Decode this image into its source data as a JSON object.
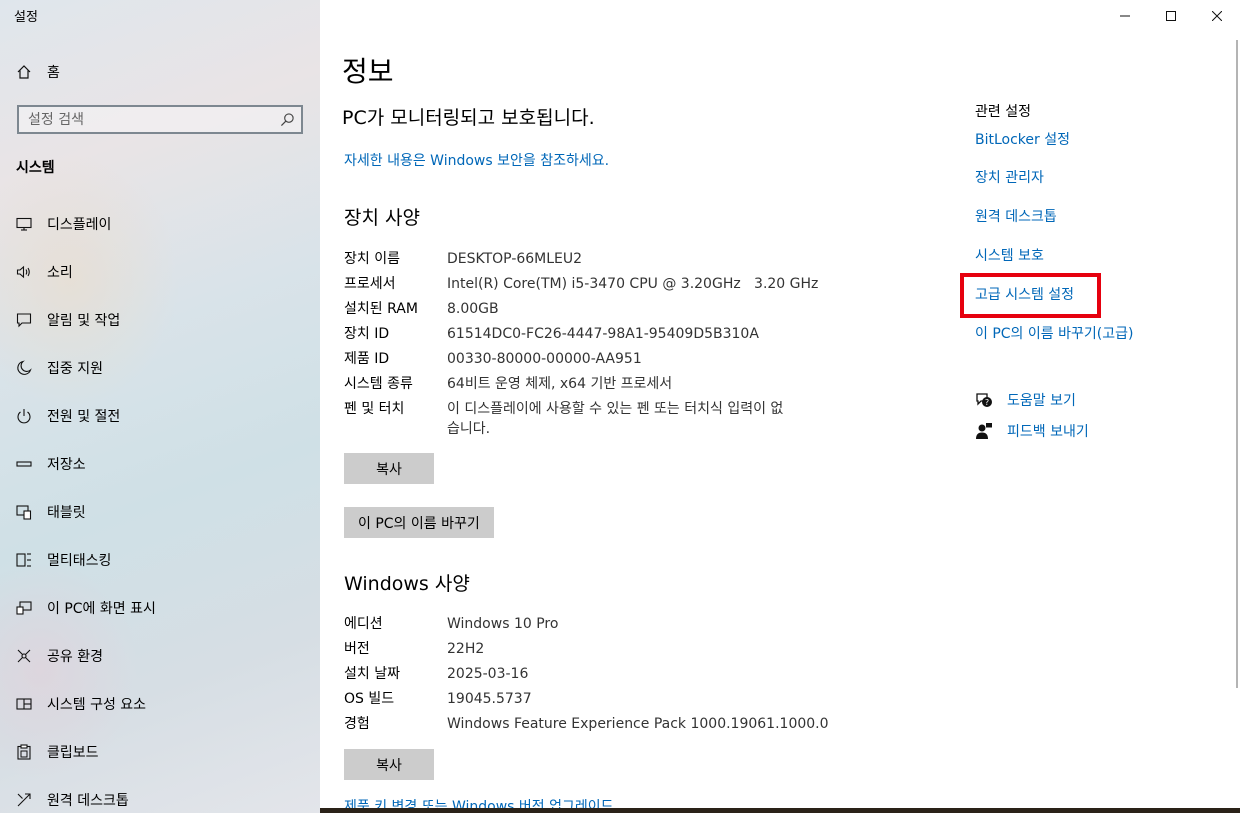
{
  "app": {
    "title": "설정"
  },
  "sidebar": {
    "home_label": "홈",
    "search_placeholder": "설정 검색",
    "section_label": "시스템",
    "items": [
      {
        "label": "디스플레이",
        "icon": "monitor-icon"
      },
      {
        "label": "소리",
        "icon": "speaker-icon"
      },
      {
        "label": "알림 및 작업",
        "icon": "notification-icon"
      },
      {
        "label": "집중 지원",
        "icon": "moon-icon"
      },
      {
        "label": "전원 및 절전",
        "icon": "power-icon"
      },
      {
        "label": "저장소",
        "icon": "storage-icon"
      },
      {
        "label": "태블릿",
        "icon": "tablet-icon"
      },
      {
        "label": "멀티태스킹",
        "icon": "multitask-icon"
      },
      {
        "label": "이 PC에 화면 표시",
        "icon": "project-icon"
      },
      {
        "label": "공유 환경",
        "icon": "share-icon"
      },
      {
        "label": "시스템 구성 요소",
        "icon": "components-icon"
      },
      {
        "label": "클립보드",
        "icon": "clipboard-icon"
      },
      {
        "label": "원격 데스크톱",
        "icon": "remote-icon"
      }
    ]
  },
  "main": {
    "title": "정보",
    "security_status": "PC가 모니터링되고 보호됩니다.",
    "security_link": "자세한 내용은 Windows 보안을 참조하세요.",
    "device_specs": {
      "heading": "장치 사양",
      "rows": [
        {
          "key": "장치 이름",
          "value": "DESKTOP-66MLEU2"
        },
        {
          "key": "프로세서",
          "value": "Intel(R) Core(TM) i5-3470 CPU @ 3.20GHz   3.20 GHz"
        },
        {
          "key": "설치된 RAM",
          "value": "8.00GB"
        },
        {
          "key": "장치 ID",
          "value": "61514DC0-FC26-4447-98A1-95409D5B310A"
        },
        {
          "key": "제품 ID",
          "value": "00330-80000-00000-AA951"
        },
        {
          "key": "시스템 종류",
          "value": "64비트 운영 체제, x64 기반 프로세서"
        },
        {
          "key": "펜 및 터치",
          "value": "이 디스플레이에 사용할 수 있는 펜 또는 터치식 입력이 없습니다."
        }
      ],
      "copy_button": "복사",
      "rename_button": "이 PC의 이름 바꾸기"
    },
    "windows_specs": {
      "heading": "Windows 사양",
      "rows": [
        {
          "key": "에디션",
          "value": "Windows 10 Pro"
        },
        {
          "key": "버전",
          "value": "22H2"
        },
        {
          "key": "설치 날짜",
          "value": "2025-03-16"
        },
        {
          "key": "OS 빌드",
          "value": "19045.5737"
        },
        {
          "key": "경험",
          "value": "Windows Feature Experience Pack 1000.19061.1000.0"
        }
      ],
      "copy_button": "복사",
      "bottom_link": "제품 키 변경 또는 Windows 버전 업그레이드"
    }
  },
  "related": {
    "title": "관련 설정",
    "links": [
      "BitLocker 설정",
      "장치 관리자",
      "원격 데스크톱",
      "시스템 보호",
      "고급 시스템 설정",
      "이 PC의 이름 바꾸기(고급)"
    ],
    "help_label": "도움말 보기",
    "feedback_label": "피드백 보내기"
  },
  "colors": {
    "link": "#0067b8",
    "highlight": "#e6000e",
    "button": "#cccccc"
  }
}
